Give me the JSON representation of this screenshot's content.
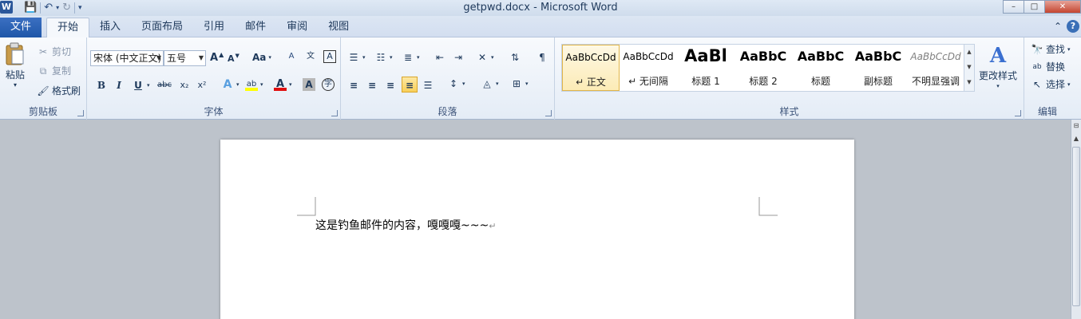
{
  "app": {
    "title": "getpwd.docx - Microsoft Word",
    "logo_letter": "W"
  },
  "window_controls": {
    "minimize": "–",
    "maximize": "□",
    "close": "✕"
  },
  "tabs": {
    "file": "文件",
    "items": [
      "开始",
      "插入",
      "页面布局",
      "引用",
      "邮件",
      "审阅",
      "视图"
    ]
  },
  "clipboard": {
    "paste": "粘贴",
    "cut": "剪切",
    "copy": "复制",
    "format_painter": "格式刷",
    "group_label": "剪贴板"
  },
  "font": {
    "font_name": "宋体 (中文正文)",
    "font_size": "五号",
    "grow": "A",
    "shrink": "A",
    "change_case": "Aa",
    "group_label": "字体"
  },
  "paragraph": {
    "group_label": "段落"
  },
  "styles": {
    "items": [
      {
        "preview": "AaBbCcDd",
        "name": "↵ 正文"
      },
      {
        "preview": "AaBbCcDd",
        "name": "↵ 无间隔"
      },
      {
        "preview": "AaBl",
        "name": "标题 1"
      },
      {
        "preview": "AaBbC",
        "name": "标题 2"
      },
      {
        "preview": "AaBbC",
        "name": "标题"
      },
      {
        "preview": "AaBbC",
        "name": "副标题"
      },
      {
        "preview": "AaBbCcDd",
        "name": "不明显强调"
      }
    ],
    "change_styles": "更改样式",
    "group_label": "样式"
  },
  "editing": {
    "find": "查找",
    "replace": "替换",
    "select": "选择",
    "group_label": "编辑"
  },
  "document": {
    "body_text": "这是钓鱼邮件的内容，嘎嘎嘎~~~",
    "paragraph_mark": "↵"
  },
  "colors": {
    "file_tab": "#2b62b4",
    "highlight": "#f8cf5a",
    "font_color_bar": "#e01010",
    "highlight_bar": "#ffff00"
  }
}
